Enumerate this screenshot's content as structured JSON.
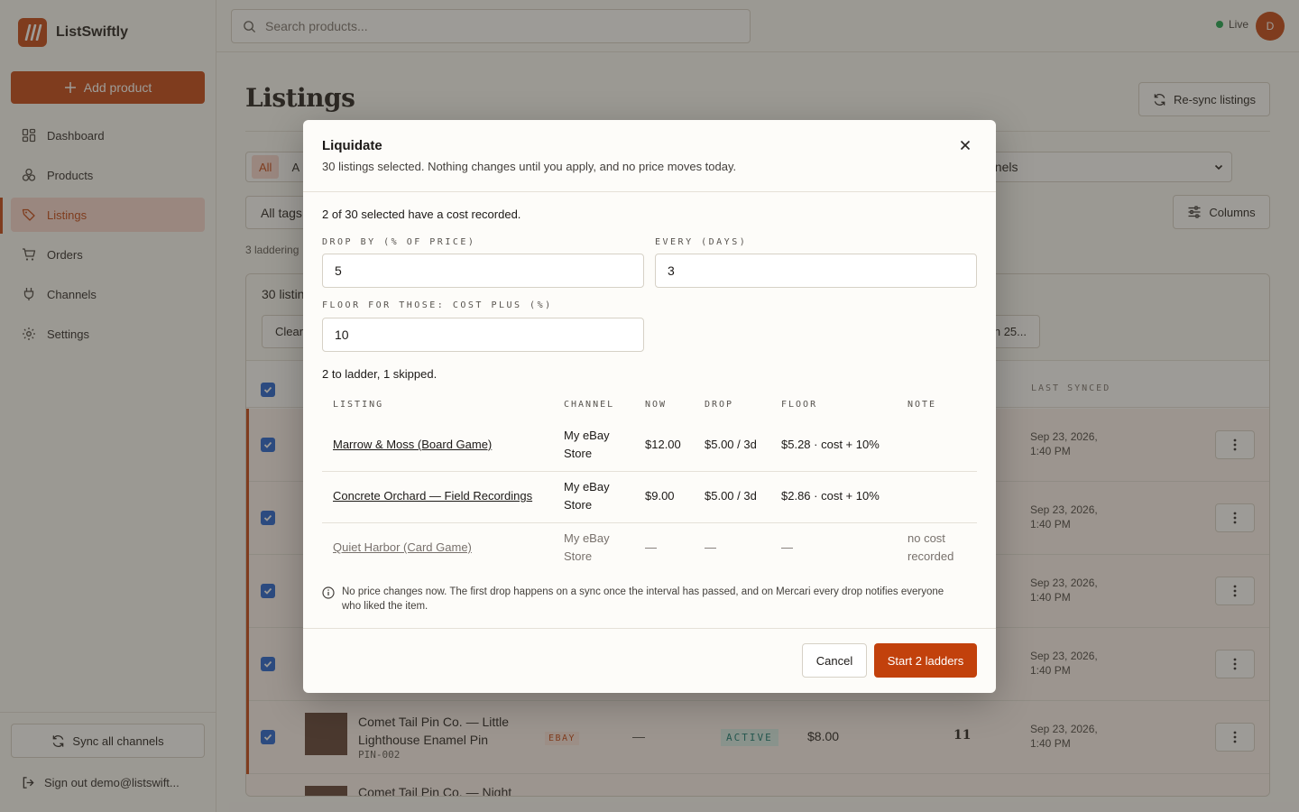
{
  "app": {
    "name": "ListSwiftly"
  },
  "sidebar": {
    "add_label": "Add product",
    "items": [
      {
        "label": "Dashboard",
        "icon": "dashboard-icon"
      },
      {
        "label": "Products",
        "icon": "products-icon"
      },
      {
        "label": "Listings",
        "icon": "tag-icon",
        "active": true
      },
      {
        "label": "Orders",
        "icon": "cart-icon"
      },
      {
        "label": "Channels",
        "icon": "plug-icon"
      },
      {
        "label": "Settings",
        "icon": "gear-icon"
      }
    ],
    "sync_label": "Sync all channels",
    "signout_label": "Sign out demo@listswift..."
  },
  "topbar": {
    "search_placeholder": "Search products...",
    "status": "Live",
    "avatar_initial": "D"
  },
  "page": {
    "title": "Listings",
    "resync_label": "Re-sync listings",
    "tabs": [
      "All",
      "A"
    ],
    "channel_filter": "nnels",
    "tags_filter": "All tags",
    "columns_label": "Columns",
    "laddering_text": "3 laddering",
    "selection_text": "30 listin",
    "clear_label": "Clear",
    "select_all_label": "n 25...",
    "col_last_synced": "LAST SYNCED",
    "rows": [
      {
        "synced_line1": "Sep 23, 2026,",
        "synced_line2": "1:40 PM"
      },
      {
        "synced_line1": "Sep 23, 2026,",
        "synced_line2": "1:40 PM"
      },
      {
        "synced_line1": "Sep 23, 2026,",
        "synced_line2": "1:40 PM"
      },
      {
        "synced_line1": "Sep 23, 2026,",
        "synced_line2": "1:40 PM"
      },
      {
        "title": "Comet Tail Pin Co. — Little Lighthouse Enamel Pin",
        "sku": "PIN-002",
        "channel": "EBAY",
        "dash": "—",
        "status": "ACTIVE",
        "price": "$8.00",
        "qty": "11",
        "synced_line1": "Sep 23, 2026,",
        "synced_line2": "1:40 PM"
      }
    ],
    "partial_row_title": "Comet Tail Pin Co. — Night"
  },
  "modal": {
    "title": "Liquidate",
    "subtitle": "30 listings selected. Nothing changes until you apply, and no price moves today.",
    "cost_note": "2 of 30 selected have a cost recorded.",
    "drop_label": "Drop by (% of price)",
    "drop_value": "5",
    "every_label": "Every (days)",
    "every_value": "3",
    "floor_label": "Floor for those: cost plus (%)",
    "floor_value": "10",
    "summary": "2 to ladder, 1 skipped.",
    "headers": {
      "listing": "LISTING",
      "channel": "CHANNEL",
      "now": "NOW",
      "drop": "DROP",
      "floor": "FLOOR",
      "note": "NOTE"
    },
    "rows": [
      {
        "listing": "Marrow & Moss (Board Game)",
        "channel": "My eBay Store",
        "now": "$12.00",
        "drop": "$5.00 / 3d",
        "floor": "$5.28 · cost + 10%",
        "note": ""
      },
      {
        "listing": "Concrete Orchard — Field Recordings",
        "channel": "My eBay Store",
        "now": "$9.00",
        "drop": "$5.00 / 3d",
        "floor": "$2.86 · cost + 10%",
        "note": ""
      },
      {
        "listing": "Quiet Harbor (Card Game)",
        "channel": "My eBay Store",
        "now": "—",
        "drop": "—",
        "floor": "—",
        "note": "no cost recorded"
      }
    ],
    "info": "No price changes now. The first drop happens on a sync once the interval has passed, and on Mercari every drop notifies everyone who liked the item.",
    "cancel_label": "Cancel",
    "start_label": "Start 2 ladders"
  },
  "colors": {
    "accent": "#c2410c",
    "accent_soft": "#f9d7cf",
    "checkbox": "#1d5fd0",
    "live": "#16a34a"
  }
}
